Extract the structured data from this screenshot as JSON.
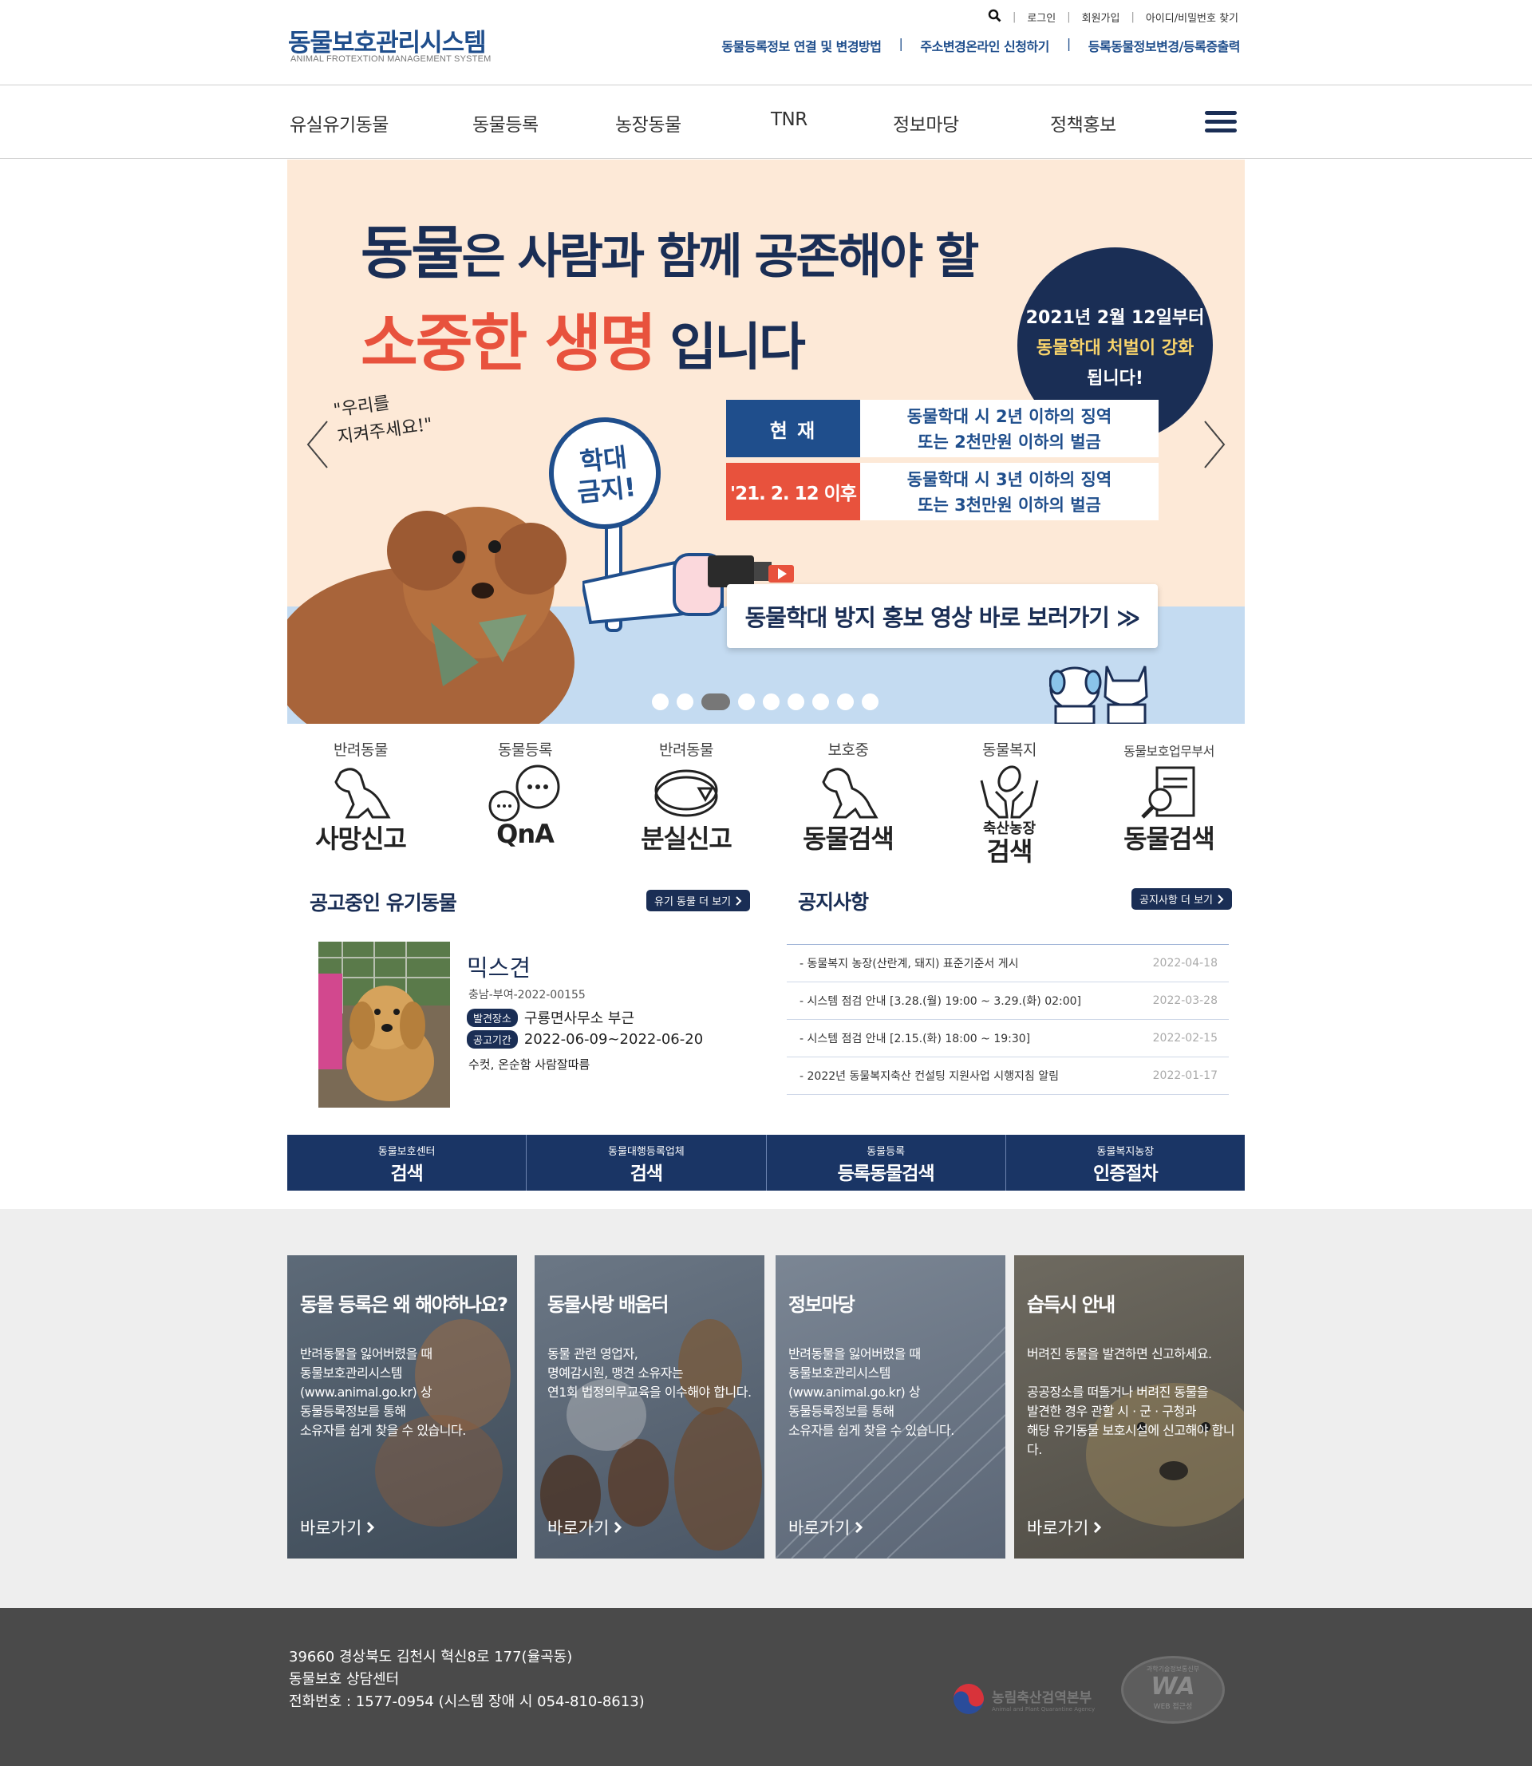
{
  "header": {
    "logo_title": "동물보호관리시스템",
    "logo_subtitle": "ANIMAL FROTEXTION MANAGEMENT SYSTEM",
    "util": [
      "로그인",
      "회원가입",
      "아이디/비밀번호 찾기"
    ],
    "quick_links": [
      "동물등록정보 연결 및 변경방법",
      "주소변경온라인 신청하기",
      "등록동물정보변경/등록증출력"
    ],
    "separator": "|"
  },
  "gnb": [
    "유실유기동물",
    "동물등록",
    "농장동물",
    "TNR",
    "정보마당",
    "정책홍보"
  ],
  "banner": {
    "line1_big": "동물",
    "line1_rest": "은 사람과 함께 공존해야 할",
    "line2_red": "소중한 생명",
    "line2_rest": " 입니다",
    "circle_line1": "2021년 2월 12일부터",
    "circle_line2": "동물학대 처벌이 강화",
    "circle_line3": "됩니다!",
    "rows": [
      {
        "label": "현  재",
        "text1": "동물학대 시 2년 이하의 징역",
        "text2": "또는 2천만원 이하의 벌금",
        "color": "#1f4e8c"
      },
      {
        "label": "'21. 2. 12 이후",
        "text1": "동물학대 시 3년 이하의 징역",
        "text2": "또는 3천만원 이하의 벌금",
        "color": "#e8523d"
      }
    ],
    "handwrite1": "\"우리를",
    "handwrite2": "지켜주세요!\"",
    "sign1": "학대",
    "sign2": "금지!",
    "video_button": "동물학대 방지 홍보 영상 바로 보러가기 ≫",
    "slide_count": 9,
    "active_slide": 3
  },
  "quick_icons": [
    {
      "top": "반려동물",
      "big": "사망신고",
      "icon": "dog-icon"
    },
    {
      "top": "동물등록",
      "big": "QnA",
      "icon": "chat-icon"
    },
    {
      "top": "반려동물",
      "big": "분실신고",
      "icon": "collar-icon"
    },
    {
      "top": "보호중",
      "big": "동물검색",
      "icon": "dog-icon"
    },
    {
      "top": "동물복지",
      "big_small": "축산농장",
      "big": "검색",
      "icon": "hands-leaf-icon"
    },
    {
      "top": "동물보호업무부서",
      "big": "동물검색",
      "icon": "document-search-icon"
    }
  ],
  "lost": {
    "title": "공고중인 유기동물",
    "more": "유기 동물 더 보기",
    "name": "믹스견",
    "id": "충남-부여-2022-00155",
    "found_tag": "발견장소",
    "found_place": "구룡면사무소 부근",
    "period_tag": "공고기간",
    "period": "2022-06-09~2022-06-20",
    "desc": "수컷, 온순함 사람잘따름"
  },
  "notice": {
    "title": "공지사항",
    "more": "공지사항 더 보기",
    "items": [
      {
        "title": "- 동물복지 농장(산란계, 돼지) 표준기준서 게시",
        "date": "2022-04-18"
      },
      {
        "title": "- 시스템 점검 안내 [3.28.(월) 19:00 ~ 3.29.(화) 02:00]",
        "date": "2022-03-28"
      },
      {
        "title": "- 시스템 점검 안내 [2.15.(화) 18:00 ~ 19:30]",
        "date": "2022-02-15"
      },
      {
        "title": "- 2022년 동물복지축산 컨설팅 지원사업 시행지침 알림",
        "date": "2022-01-17"
      }
    ]
  },
  "searchbar": [
    {
      "small": "동물보호센터",
      "big": "검색"
    },
    {
      "small": "동물대행등록업체",
      "big": "검색"
    },
    {
      "small": "동물등록",
      "big": "등록동물검색"
    },
    {
      "small": "동물복지농장",
      "big": "인증절차"
    }
  ],
  "cards": [
    {
      "title": "동물 등록은 왜 해야하나요?",
      "lines": [
        "반려동물을 잃어버렸을 때",
        "동물보호관리시스템",
        "(www.animal.go.kr) 상",
        "동물등록정보를 통해",
        "소유자를 쉽게 찾을 수 있습니다."
      ],
      "link": "바로가기"
    },
    {
      "title": "동물사랑 배움터",
      "lines": [
        "동물 관련 영업자,",
        "명예감시원, 맹견 소유자는",
        "연1회 법정의무교육을 이수해야 합니다."
      ],
      "link": "바로가기"
    },
    {
      "title": "정보마당",
      "lines": [
        "반려동물을 잃어버렸을 때",
        "동물보호관리시스템",
        "(www.animal.go.kr) 상",
        "동물등록정보를 통해",
        "소유자를 쉽게 찾을 수 있습니다."
      ],
      "link": "바로가기"
    },
    {
      "title": "습득시 안내",
      "lines": [
        "버려진 동물을 발견하면 신고하세요.",
        "",
        "공공장소를 떠돌거나 버려진 동물을",
        "발견한 경우 관할 시 · 군 · 구청과",
        "해당 유기동물 보호시설에 신고해야 합니다."
      ],
      "link": "바로가기"
    }
  ],
  "footer": {
    "address": "39660 경상북도 김천시 혁신8로 177(율곡동)",
    "center": "동물보호 상담센터",
    "phone": "전화번호 : 1577-0954 (시스템 장애 시 054-810-8613)",
    "agency": "농림축산검역본부",
    "agency_en": "Animal and Plant Quarantine Agency",
    "wa_top": "과학기술정보통신부",
    "wa_mark": "WA",
    "wa_bottom": "WEB 접근성"
  }
}
